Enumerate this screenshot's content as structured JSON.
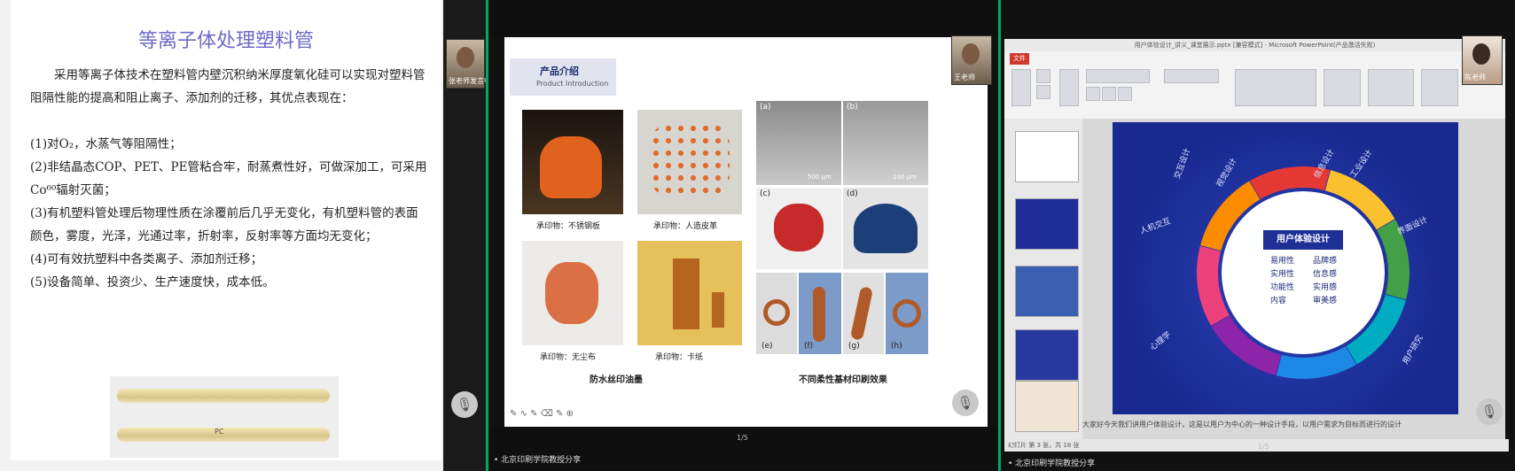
{
  "panel1": {
    "title": "等离子体处理塑料管",
    "paragraphs": [
      "采用等离子体技术在塑料管内壁沉积纳米厚度氧化硅可以实现对塑料管阻隔性能的提高和阻止离子、添加剂的迁移，其优点表现在：",
      "(1)对O₂，水蒸气等阻隔性；",
      "(2)非结晶态COP、PET、PE管粘合牢，耐蒸煮性好，可做深加工，可采用Co⁶⁰辐射灭菌；",
      "(3)有机塑料管处理后物理性质在涂覆前后几乎无变化，有机塑料管的表面颜色，雾度，光泽，光通过率，折射率，反射率等方面均无变化；",
      "(4)可有效抗塑料中各类离子、添加剂迁移；",
      "(5)设备简单、投资少、生产速度快，成本低。"
    ],
    "tube_label": "PC",
    "cam_name": "张老师发言中"
  },
  "panel2": {
    "header_title": "产品介绍",
    "header_sub": "Product Introduction",
    "captions": [
      "承印物：不锈钢板",
      "承印物：人造皮革",
      "承印物：无尘布",
      "承印物：卡纸"
    ],
    "section_left": "防水丝印油墨",
    "section_right": "不同柔性基材印刷效果",
    "panel_tags": [
      "(a)",
      "(b)",
      "(c)",
      "(d)",
      "(e)",
      "(f)",
      "(g)",
      "(h)"
    ],
    "scale_labels": [
      "500 μm",
      "100 μm"
    ],
    "cam_name": "王老师",
    "page_no": "1/5",
    "status": "• 北京印刷学院教授分享"
  },
  "panel3": {
    "window_title": "用户体验设计_讲义_课堂展示.pptx [兼容模式] - Microsoft PowerPoint(产品激活失败)",
    "file_tab": "文件",
    "ring_center": "用户体验设计",
    "ring_items": [
      "易用性",
      "实用性",
      "功能性",
      "内容"
    ],
    "ring_items_right": [
      "品牌感",
      "信息感",
      "实用感",
      "审美感"
    ],
    "outer_labels": [
      "交互设计",
      "视觉设计",
      "信息设计",
      "工业设计",
      "人机交互",
      "界面设计",
      "心理学",
      "用户研究"
    ],
    "note": "大家好今天我们讲用户体验设计，这是以用户为中心的一种设计手段，以用户需求为目标而进行的设计",
    "status": "幻灯片 第 3 张，共 18 张",
    "page_no": "1/5",
    "cam_name": "陈老师",
    "footer": "• 北京印刷学院教授分享"
  }
}
